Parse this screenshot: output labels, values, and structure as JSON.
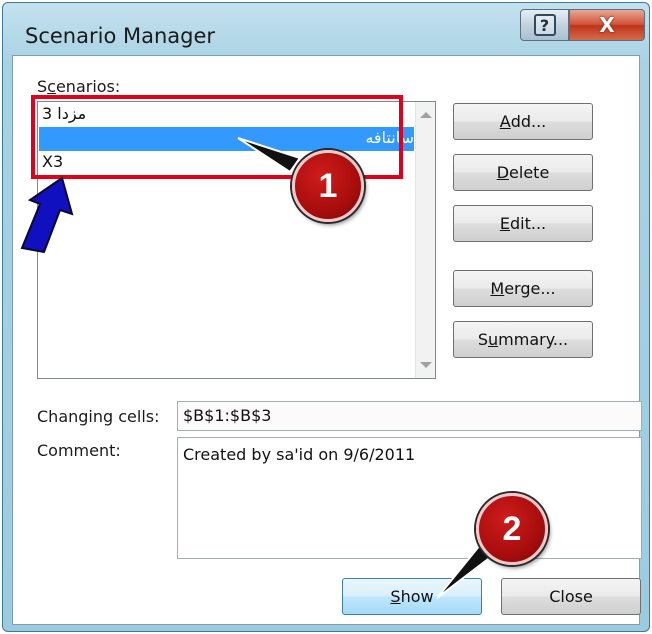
{
  "window": {
    "title": "Scenario Manager",
    "help_glyph": "?",
    "close_glyph": "X"
  },
  "scenarios": {
    "label_prefix": "S",
    "label_access": "c",
    "label_suffix": "enarios:",
    "items": [
      {
        "label": "مزدا 3",
        "selected": false
      },
      {
        "label": "سانتافه",
        "selected": true
      },
      {
        "label": "X3",
        "selected": false
      }
    ]
  },
  "buttons": {
    "add": {
      "pre": "",
      "key": "A",
      "post": "dd..."
    },
    "delete": {
      "pre": "",
      "key": "D",
      "post": "elete"
    },
    "edit": {
      "pre": "",
      "key": "E",
      "post": "dit..."
    },
    "merge": {
      "pre": "",
      "key": "M",
      "post": "erge..."
    },
    "summary": {
      "pre": "S",
      "key": "u",
      "post": "mmary..."
    },
    "show": {
      "pre": "",
      "key": "S",
      "post": "how"
    },
    "close": "Close"
  },
  "changing_cells": {
    "label": "Changing cells:",
    "value": "$B$1:$B$3"
  },
  "comment": {
    "label": "Comment:",
    "value": "Created by sa'id on 9/6/2011"
  },
  "annotations": [
    {
      "number": "1",
      "color": "#a80d0d"
    },
    {
      "number": "2",
      "color": "#a80d0d"
    }
  ],
  "colors": {
    "selection": "#3399ff",
    "annotation_red": "#e0001b",
    "arrow_blue": "#1010c0"
  }
}
